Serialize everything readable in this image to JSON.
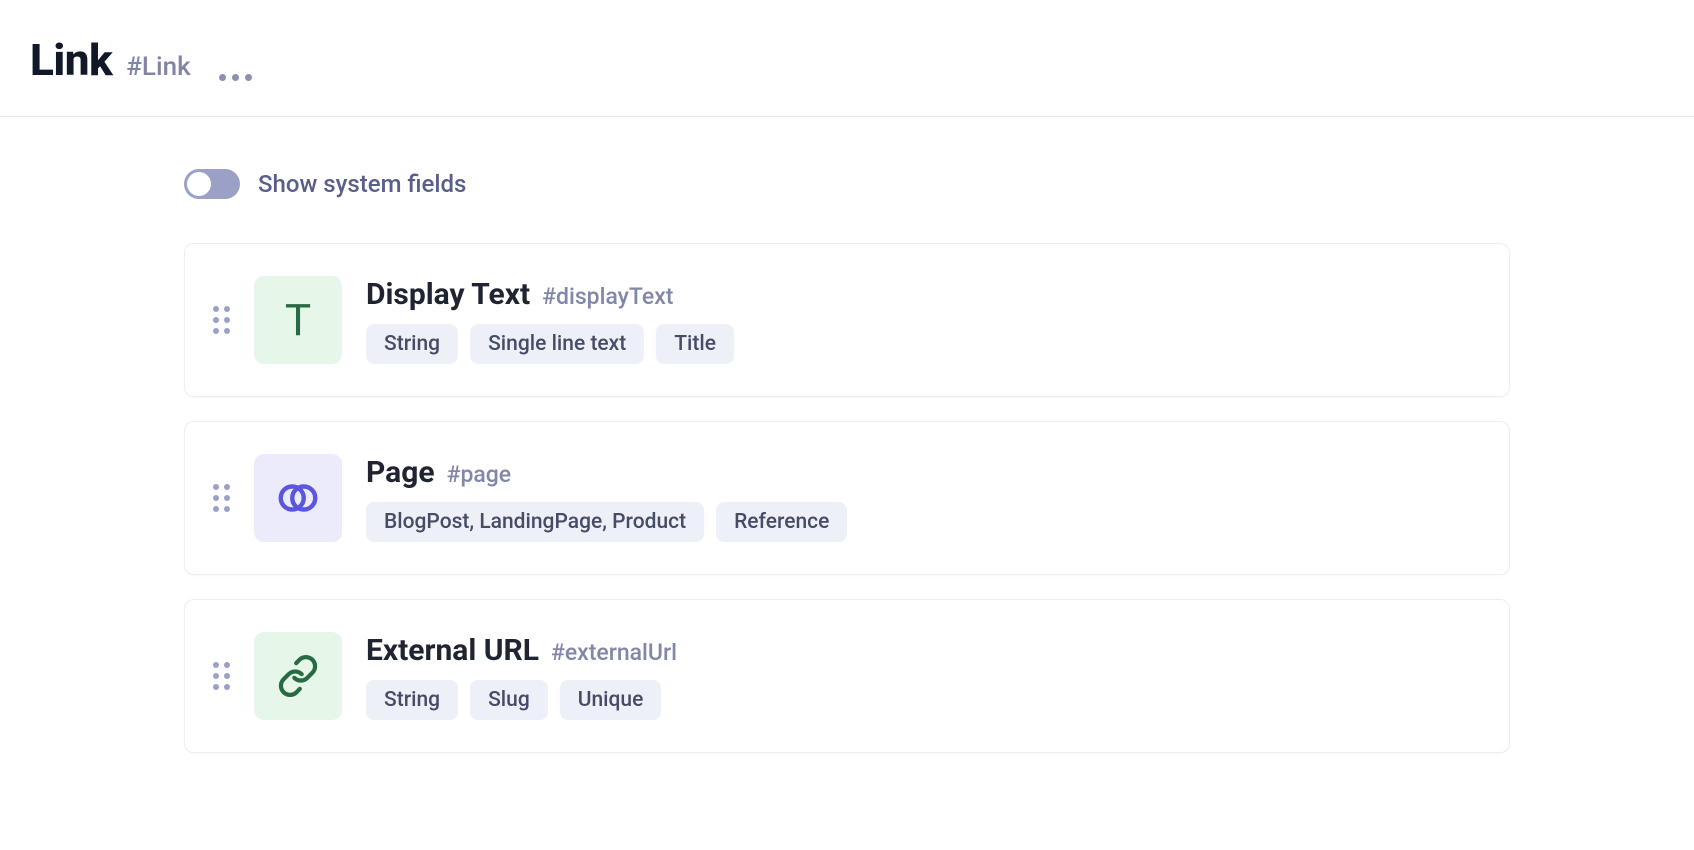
{
  "header": {
    "title": "Link",
    "id": "#Link"
  },
  "toggle": {
    "label": "Show system fields",
    "on": false
  },
  "fields": [
    {
      "icon": "text-icon",
      "iconVariant": "green",
      "title": "Display Text",
      "id": "#displayText",
      "tags": [
        "String",
        "Single line text",
        "Title"
      ]
    },
    {
      "icon": "reference-icon",
      "iconVariant": "purple",
      "title": "Page",
      "id": "#page",
      "tags": [
        "BlogPost, LandingPage, Product",
        "Reference"
      ]
    },
    {
      "icon": "link-icon",
      "iconVariant": "green",
      "title": "External URL",
      "id": "#externalUrl",
      "tags": [
        "String",
        "Slug",
        "Unique"
      ]
    }
  ]
}
